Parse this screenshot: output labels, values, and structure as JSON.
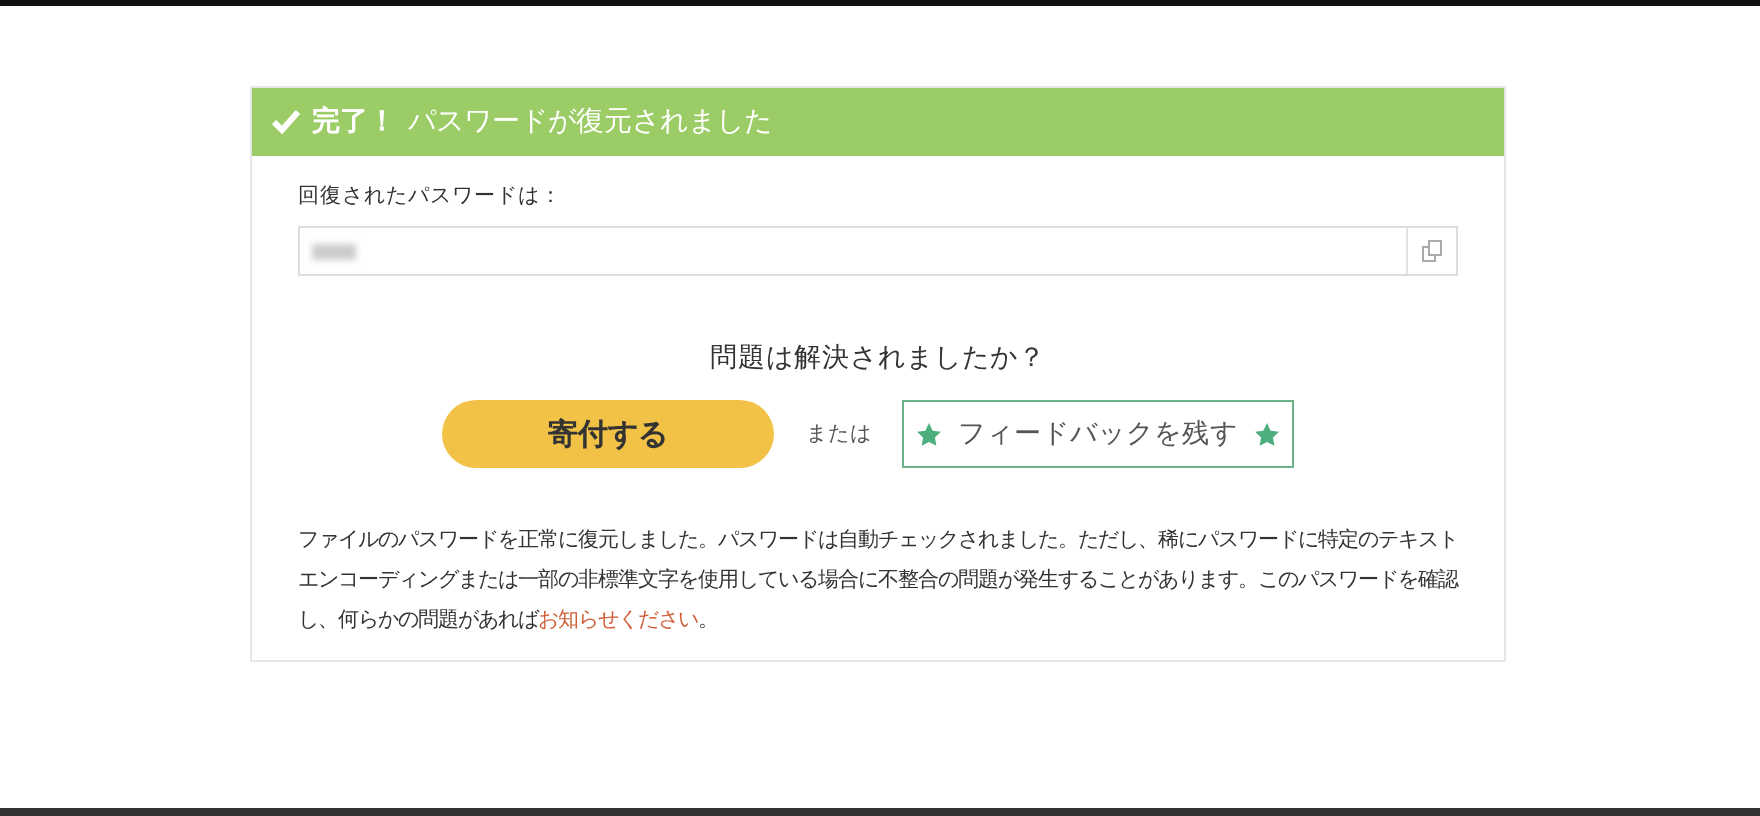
{
  "banner": {
    "title": "完了！",
    "message": "パスワードが復元されました"
  },
  "password": {
    "label": "回復されたパスワードは："
  },
  "question": "問題は解決されましたか？",
  "donate_button": "寄付する",
  "separator": "または",
  "feedback_button": "フィードバックを残す",
  "notice": {
    "text": "ファイルのパスワードを正常に復元しました。パスワードは自動チェックされました。ただし、稀にパスワードに特定のテキストエンコーディングまたは一部の非標準文字を使用している場合に不整合の問題が発生することがあります。このパスワードを確認し、何らかの問題があれば",
    "link": "お知らせください",
    "end": "。"
  }
}
